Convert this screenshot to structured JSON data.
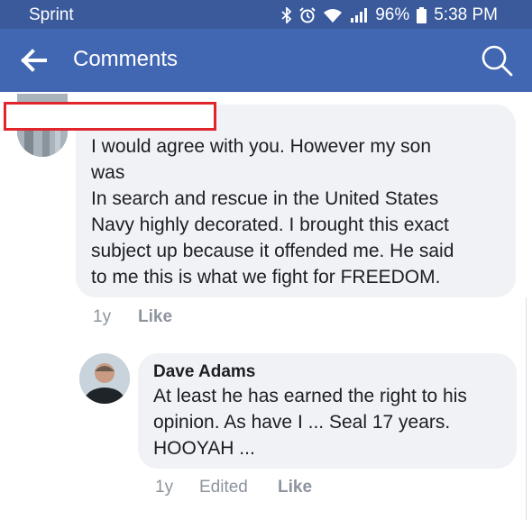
{
  "status_bar": {
    "carrier": "Sprint",
    "battery": "96%",
    "time": "5:38 PM",
    "icons": [
      "bluetooth-icon",
      "alarm-icon",
      "wifi-icon",
      "signal-icon",
      "battery-icon"
    ]
  },
  "app_bar": {
    "title": "Comments",
    "back_icon": "back-arrow-icon",
    "search_icon": "search-icon",
    "colors": {
      "status": "#3a5a9c",
      "bar": "#4267b2"
    }
  },
  "comments": [
    {
      "author": "",
      "text": "I would agree with you. However my son\nwas\nIn search and rescue in the United States\nNavy highly decorated. I brought this exact\nsubject up because it offended me. He said\nto me this is what we fight for FREEDOM.",
      "age": "1y",
      "like_label": "Like"
    },
    {
      "author": "Dave Adams",
      "text": "At least he has earned the right to his\nopinion. As have I ... Seal 17 years.\nHOOYAH ...",
      "age": "1y",
      "edited_label": "Edited",
      "like_label": "Like"
    }
  ]
}
